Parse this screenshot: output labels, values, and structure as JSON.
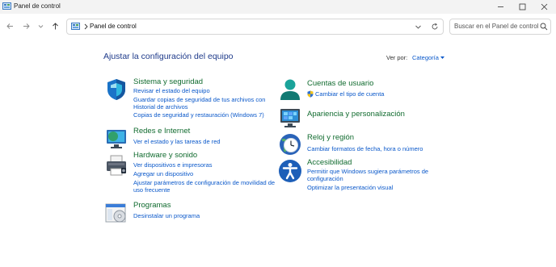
{
  "window": {
    "title": "Panel de control",
    "controls": [
      "minimize-icon",
      "maximize-icon",
      "close-icon"
    ]
  },
  "navigation": {
    "buttons": [
      "back-arrow-icon",
      "forward-arrow-icon",
      "recent-dropdown-icon",
      "up-arrow-icon"
    ],
    "address": "Panel de control",
    "search_placeholder": "Buscar en el Panel de control"
  },
  "content": {
    "heading": "Ajustar la configuración del equipo",
    "view_by_label": "Ver por:",
    "view_by_value": "Categoría",
    "colors": {
      "title_green": "#116b2f",
      "link_blue": "#0a58ca",
      "heading_blue": "#1e3a8a"
    }
  },
  "categories": {
    "security": {
      "title": "Sistema y seguridad",
      "links": [
        "Revisar el estado del equipo",
        "Guardar copias de seguridad de tus archivos con",
        "Historial de archivos",
        "Copias de seguridad y restauración (Windows 7)"
      ]
    },
    "network": {
      "title": "Redes e Internet",
      "links": [
        "Ver el estado y las tareas de red"
      ]
    },
    "hardware": {
      "title": "Hardware y sonido",
      "links": [
        "Ver dispositivos e impresoras",
        "Agregar un dispositivo",
        "Ajustar parámetros de configuración de movilidad de",
        "uso frecuente"
      ]
    },
    "programs": {
      "title": "Programas",
      "links": [
        "Desinstalar un programa"
      ]
    },
    "accounts": {
      "title": "Cuentas de usuario",
      "links": [
        "Cambiar el tipo de cuenta"
      ]
    },
    "appearance": {
      "title": "Apariencia y personalización",
      "links": []
    },
    "clock": {
      "title": "Reloj y región",
      "links": [
        "Cambiar formatos de fecha, hora o número"
      ]
    },
    "accessibility": {
      "title": "Accesibilidad",
      "links": [
        "Permitir que Windows sugiera parámetros de",
        "configuración",
        "Optimizar la presentación visual"
      ]
    }
  }
}
